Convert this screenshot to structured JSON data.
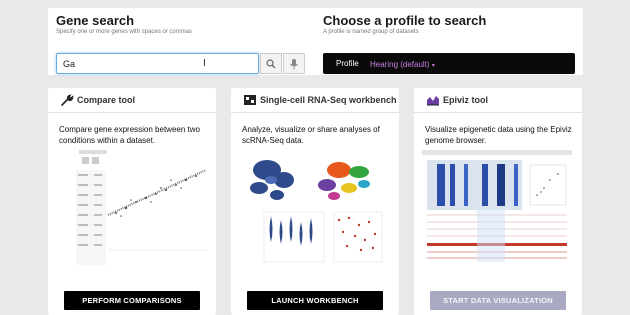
{
  "gene_search": {
    "title": "Gene search",
    "subtitle": "Specify one or more genes with spaces or commas",
    "input_value": "Ga"
  },
  "profile": {
    "title": "Choose a profile to search",
    "subtitle": "A profile is named group of datasets",
    "label": "Profile",
    "value": "Hearing (default)",
    "caret": "▾"
  },
  "cards": [
    {
      "title": "Compare tool",
      "icon": "wrench-icon",
      "description": "Compare gene expression between two conditions within a dataset.",
      "button": "PERFORM COMPARISONS",
      "button_enabled": true
    },
    {
      "title": "Single-cell RNA-Seq workbench",
      "icon": "wrench-icon",
      "description": "Analyze, visualize or share analyses of scRNA-Seq data.",
      "button": "LAUNCH WORKBENCH",
      "button_enabled": true
    },
    {
      "title": "Epiviz tool",
      "icon": "chart-icon",
      "description": "Visualize epigenetic data using the Epiviz genome browser.",
      "button": "START DATA VISUALIZATION",
      "button_enabled": false
    }
  ],
  "colors": {
    "profile_value": "#c77de0",
    "button": "#000000",
    "button_disabled": "#a9a9c2",
    "input_focus": "#6aa9dd"
  }
}
